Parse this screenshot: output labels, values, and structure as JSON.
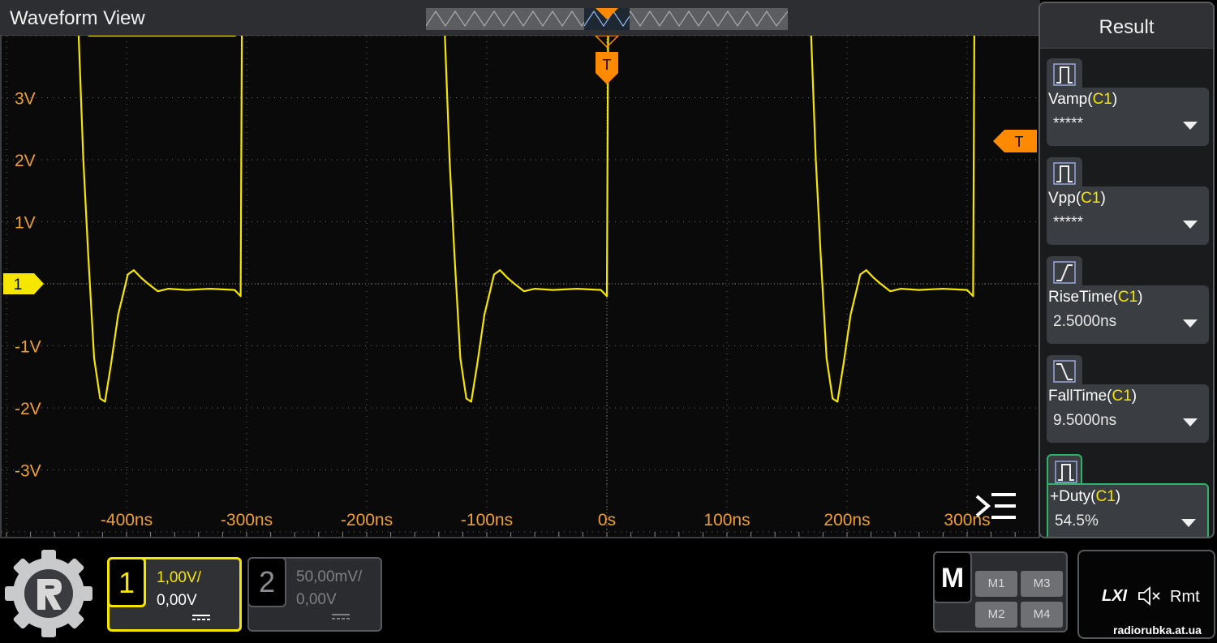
{
  "waveform": {
    "title": "Waveform View",
    "trigger_marker_label": "T",
    "trigger_level_label": "T",
    "channel_marker_label": "1",
    "y_axis_labels": [
      "3V",
      "2V",
      "1V",
      "-1V",
      "-2V",
      "-3V"
    ],
    "x_axis_labels": [
      "-400ns",
      "-300ns",
      "-200ns",
      "-100ns",
      "0s",
      "100ns",
      "200ns",
      "300ns"
    ]
  },
  "result_panel": {
    "title": "Result",
    "measurements": [
      {
        "name": "Vamp",
        "channel": "C1",
        "value": "*****",
        "icon": "pulse-amplitude-icon"
      },
      {
        "name": "Vpp",
        "channel": "C1",
        "value": "*****",
        "icon": "pulse-peak-icon"
      },
      {
        "name": "RiseTime",
        "channel": "C1",
        "value": "2.5000ns",
        "icon": "rise-edge-icon"
      },
      {
        "name": "FallTime",
        "channel": "C1",
        "value": "9.5000ns",
        "icon": "fall-edge-icon"
      },
      {
        "name": "+Duty",
        "channel": "C1",
        "value": "54.5%",
        "icon": "duty-cycle-icon"
      }
    ]
  },
  "channels": {
    "ch1": {
      "number": "1",
      "scale": "1,00V/",
      "offset": "0,00V"
    },
    "ch2": {
      "number": "2",
      "scale": "50,00mV/",
      "offset": "0,00V"
    }
  },
  "math": {
    "label": "M",
    "buttons": [
      "M1",
      "M3",
      "M2",
      "M4"
    ]
  },
  "status": {
    "lxi": "LXI",
    "rmt": "Rmt"
  },
  "watermark": "radiorubka.at.ua",
  "colors": {
    "ch1": "#f5e600",
    "trigger": "#ff8a00",
    "selected": "#2fb36a"
  }
}
